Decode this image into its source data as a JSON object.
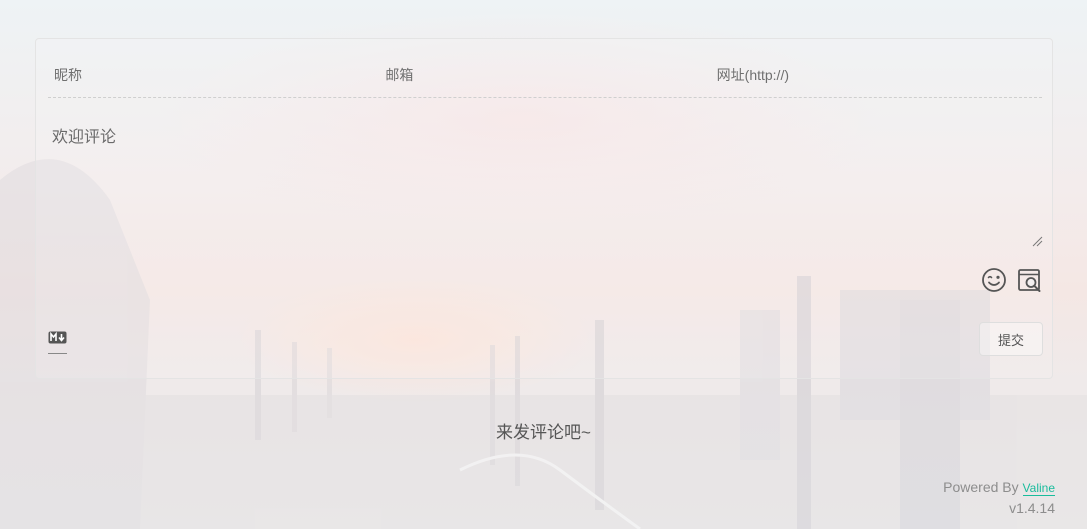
{
  "form": {
    "nick_placeholder": "昵称",
    "mail_placeholder": "邮箱",
    "link_placeholder": "网址(http://)",
    "comment_placeholder": "欢迎评论",
    "submit_label": "提交"
  },
  "icons": {
    "emoji": "emoji-icon",
    "preview": "preview-icon",
    "markdown": "markdown-icon"
  },
  "comments": {
    "empty_text": "来发评论吧~"
  },
  "footer": {
    "powered_by": "Powered By",
    "brand": "Valine",
    "version": "v1.4.14"
  },
  "colors": {
    "brand": "#1abc9c",
    "text": "#555555",
    "border": "#e4e4e4"
  }
}
